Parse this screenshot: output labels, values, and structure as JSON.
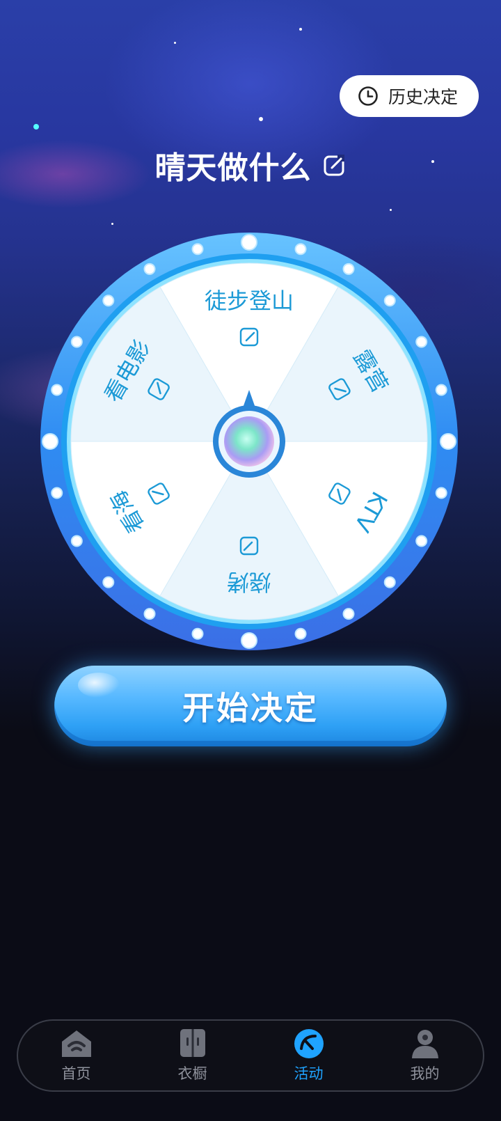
{
  "header": {
    "history_label": "历史决定",
    "title": "晴天做什么"
  },
  "wheel": {
    "segments": [
      {
        "label": "徒步登山"
      },
      {
        "label": "露营"
      },
      {
        "label": "KTV"
      },
      {
        "label": "烧烤"
      },
      {
        "label": "看海"
      },
      {
        "label": "看电影"
      }
    ],
    "colors": {
      "light": "#ffffff",
      "tint": "#eaf5fc",
      "text": "#1c9ad6",
      "rim": "#2e8cf0"
    }
  },
  "start_button": {
    "label": "开始决定"
  },
  "tabbar": {
    "items": [
      {
        "label": "首页",
        "icon": "home-icon",
        "active": false
      },
      {
        "label": "衣橱",
        "icon": "wardrobe-icon",
        "active": false
      },
      {
        "label": "活动",
        "icon": "activity-icon",
        "active": true
      },
      {
        "label": "我的",
        "icon": "profile-icon",
        "active": false
      }
    ]
  }
}
